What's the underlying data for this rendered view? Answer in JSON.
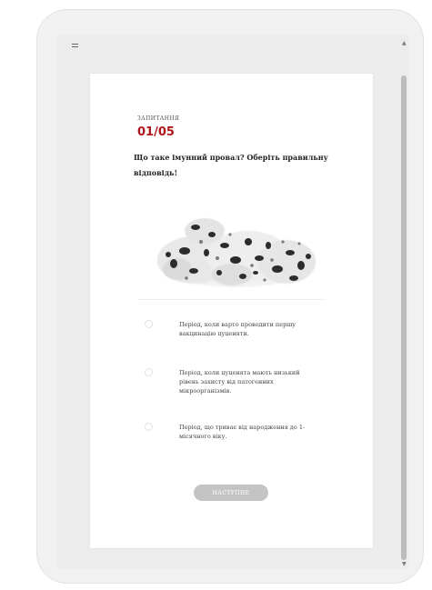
{
  "quiz": {
    "question_label": "ЗАПИТАННЯ",
    "counter": "01/05",
    "question": "Що таке імунний провал? Оберіть правильну відповідь!",
    "options": [
      "Період, коли варто проводити першу вакцинацію цуценяти.",
      "Період, коли цуценята мають низький рівень захисту від патогенних мікроорганізмів.",
      "Період, що триває від народження до 1-місячного віку."
    ],
    "next_label": "НАСТУПНЕ"
  },
  "colors": {
    "accent": "#b2141b",
    "button_disabled": "#c4c4c4",
    "frame": "#f1f1f1",
    "scrollbar": "#bcbcbc"
  },
  "icons": {
    "menu": "menu-icon",
    "scroll_up": "arrow-up-icon",
    "scroll_down": "arrow-down-icon"
  }
}
